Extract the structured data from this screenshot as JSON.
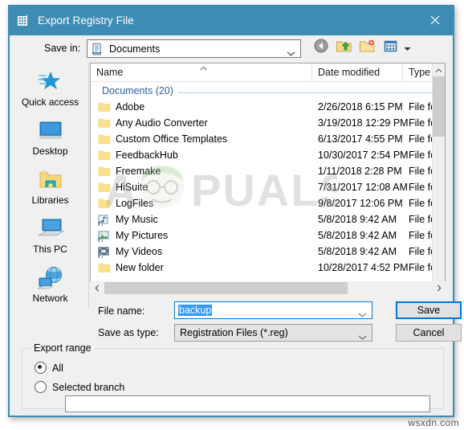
{
  "window": {
    "title": "Export Registry File",
    "title_icon": "registry-grid-icon",
    "close_icon": "close-icon",
    "accent_color": "#3e8cb5"
  },
  "toolbar": {
    "save_in_label": "Save in:",
    "save_in_value": "Documents",
    "save_in_icon": "document-folder-icon",
    "back_icon": "back-arrow-icon",
    "up_icon": "up-one-level-icon",
    "new_folder_icon": "new-folder-icon",
    "views_icon": "views-icon",
    "views_dropdown_icon": "chevron-down-icon"
  },
  "places": {
    "items": [
      {
        "label": "Quick access",
        "icon": "quick-access-star-icon"
      },
      {
        "label": "Desktop",
        "icon": "desktop-monitor-icon"
      },
      {
        "label": "Libraries",
        "icon": "libraries-folder-icon"
      },
      {
        "label": "This PC",
        "icon": "this-pc-computer-icon"
      },
      {
        "label": "Network",
        "icon": "network-globe-icon"
      }
    ]
  },
  "file_list": {
    "columns": [
      "Name",
      "Date modified",
      "Type"
    ],
    "sort_indicator": "ascending-caret-icon",
    "group_header": "Documents (20)",
    "rows": [
      {
        "name": "Adobe",
        "date": "2/26/2018 6:15 PM",
        "type": "File fol",
        "icon": "folder-icon"
      },
      {
        "name": "Any Audio Converter",
        "date": "3/19/2018 12:29 PM",
        "type": "File fol",
        "icon": "folder-icon"
      },
      {
        "name": "Custom Office Templates",
        "date": "6/13/2017 4:55 PM",
        "type": "File fol",
        "icon": "folder-icon"
      },
      {
        "name": "FeedbackHub",
        "date": "10/30/2017 2:54 PM",
        "type": "File fol",
        "icon": "folder-icon"
      },
      {
        "name": "Freemake",
        "date": "1/11/2018 2:28 PM",
        "type": "File fol",
        "icon": "folder-icon"
      },
      {
        "name": "HiSuite",
        "date": "7/31/2017 12:08 AM",
        "type": "File fol",
        "icon": "folder-icon"
      },
      {
        "name": "LogFiles",
        "date": "9/8/2017 12:06 PM",
        "type": "File fol",
        "icon": "folder-icon"
      },
      {
        "name": "My Music",
        "date": "5/8/2018 9:42 AM",
        "type": "File fol",
        "icon": "music-library-icon"
      },
      {
        "name": "My Pictures",
        "date": "5/8/2018 9:42 AM",
        "type": "File fol",
        "icon": "pictures-library-icon"
      },
      {
        "name": "My Videos",
        "date": "5/8/2018 9:42 AM",
        "type": "File fol",
        "icon": "videos-library-icon"
      },
      {
        "name": "New folder",
        "date": "10/28/2017 4:52 PM",
        "type": "File fol",
        "icon": "folder-icon"
      }
    ]
  },
  "form": {
    "file_name_label": "File name:",
    "file_name_value": "backup",
    "save_as_type_label": "Save as type:",
    "save_as_type_value": "Registration Files (*.reg)",
    "save_button": "Save",
    "cancel_button": "Cancel"
  },
  "export_range": {
    "title": "Export range",
    "options": [
      {
        "label": "All",
        "selected": true
      },
      {
        "label": "Selected branch",
        "selected": false
      }
    ],
    "branch_value": ""
  },
  "watermark": {
    "overlay_text": "APPUALS",
    "corner_text": "wsxdn.com"
  }
}
